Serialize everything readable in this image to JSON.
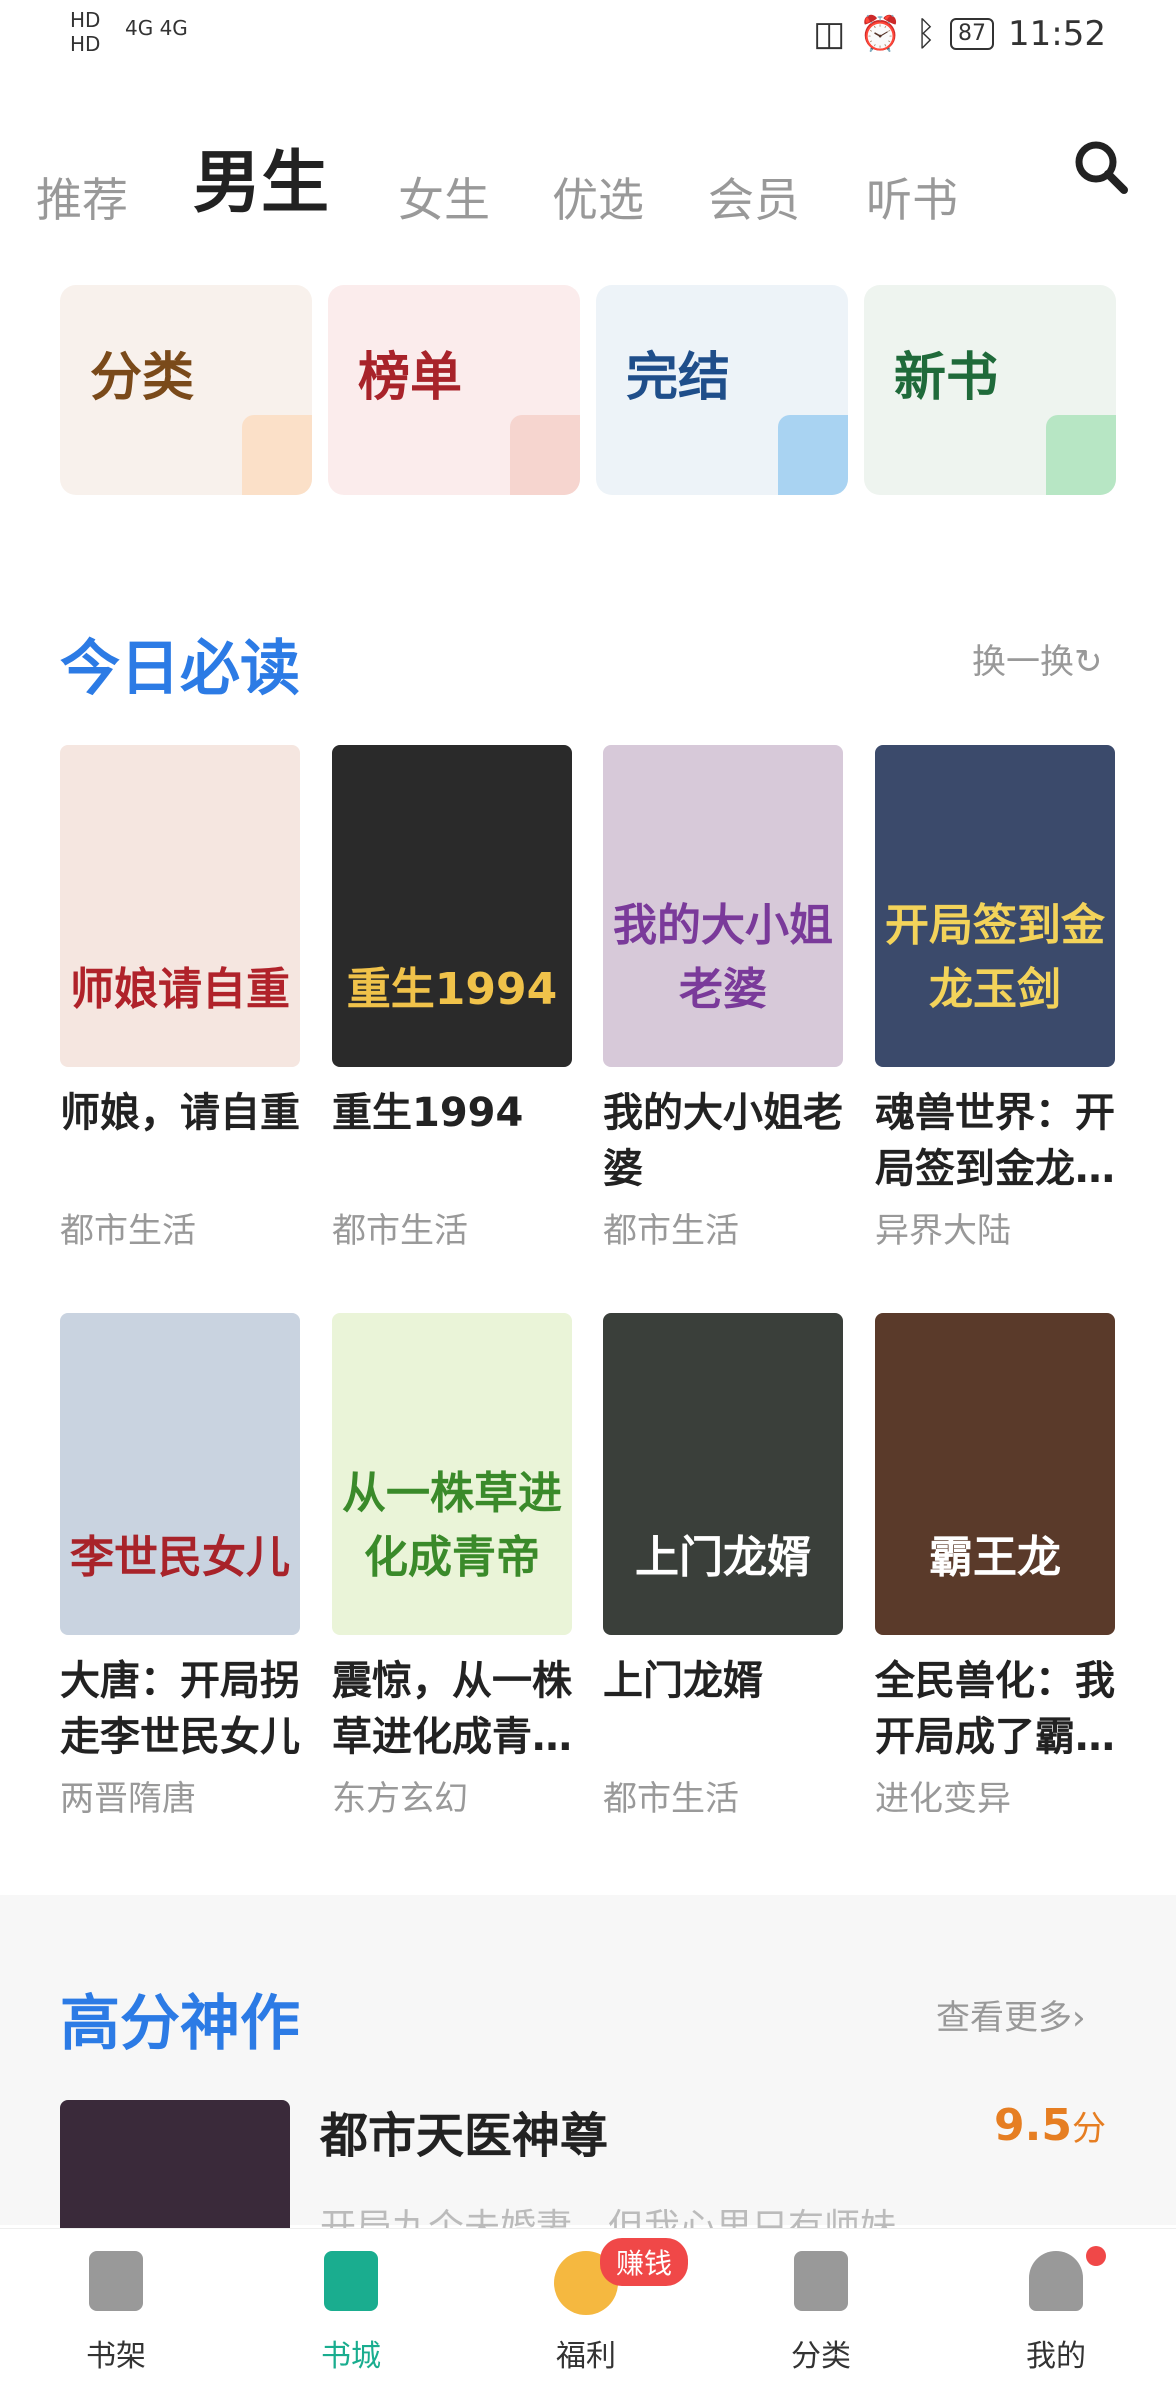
{
  "status_bar": {
    "hd": "HD1\nHD2",
    "signal": "4G 4G",
    "battery": "87",
    "time": "11:52"
  },
  "tabs": [
    "推荐",
    "男生",
    "女生",
    "优选",
    "会员",
    "听书"
  ],
  "categories": [
    {
      "label": "分类",
      "color": "#7a4a1a",
      "bg": "#f8f1ec"
    },
    {
      "label": "榜单",
      "color": "#a8232a",
      "bg": "#fbecec"
    },
    {
      "label": "完结",
      "color": "#1f4e8a",
      "bg": "#edf3f8"
    },
    {
      "label": "新书",
      "color": "#1f6a3a",
      "bg": "#eef4ef"
    }
  ],
  "section1": {
    "title": "今日必读",
    "action": "换一换"
  },
  "books": [
    {
      "title": "师娘，请自重",
      "category": "都市生活",
      "cover_text": "师娘请自重",
      "bg": "#f5e6e0"
    },
    {
      "title": "重生1994",
      "category": "都市生活",
      "cover_text": "重生1994",
      "bg": "#2a2a2a"
    },
    {
      "title": "我的大小姐老婆",
      "category": "都市生活",
      "cover_text": "我的大小姐老婆",
      "bg": "#d7c9d9"
    },
    {
      "title": "魂兽世界：开局签到金龙…",
      "category": "异界大陆",
      "cover_text": "开局签到金龙玉剑",
      "bg": "#3b4a6b"
    },
    {
      "title": "大唐：开局拐走李世民女儿",
      "category": "两晋隋唐",
      "cover_text": "李世民女儿",
      "bg": "#c9d3e0"
    },
    {
      "title": "震惊，从一株草进化成青…",
      "category": "东方玄幻",
      "cover_text": "从一株草进化成青帝",
      "bg": "#eaf4d8"
    },
    {
      "title": "上门龙婿",
      "category": "都市生活",
      "cover_text": "上门龙婿",
      "bg": "#3a3f3a"
    },
    {
      "title": "全民兽化：我开局成了霸…",
      "category": "进化变异",
      "cover_text": "霸王龙",
      "bg": "#5a3a2a"
    }
  ],
  "section2": {
    "title": "高分神作",
    "action": "查看更多",
    "book_title": "都市天医神尊",
    "score": "9.5",
    "score_unit": "分",
    "summary": "开局九个未婚妻，但我心里只有师妹—"
  },
  "nav": [
    {
      "label": "书架",
      "icon": "bookshelf-icon",
      "active": false
    },
    {
      "label": "书城",
      "icon": "bookstore-icon",
      "active": true
    },
    {
      "label": "福利",
      "icon": "coin-icon",
      "active": false
    },
    {
      "label": "分类",
      "icon": "category-icon",
      "active": false
    },
    {
      "label": "我的",
      "icon": "profile-icon",
      "active": false
    }
  ],
  "nav_badge": "赚钱",
  "accent": "#1aad8f",
  "section_color": "#2c7be5"
}
